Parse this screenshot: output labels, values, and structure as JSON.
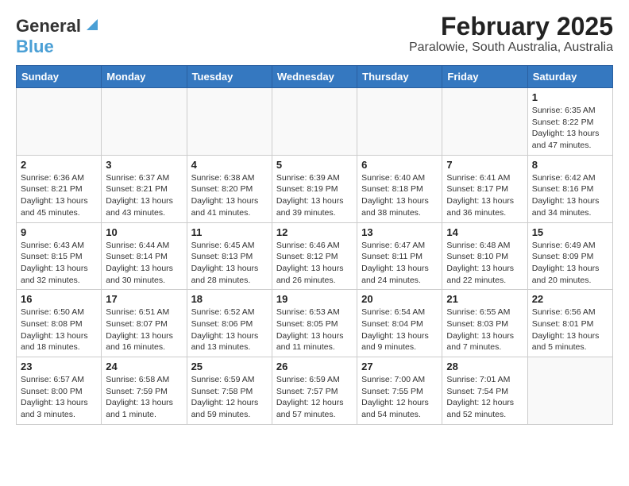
{
  "header": {
    "logo_general": "General",
    "logo_blue": "Blue",
    "title": "February 2025",
    "subtitle": "Paralowie, South Australia, Australia"
  },
  "calendar": {
    "days_of_week": [
      "Sunday",
      "Monday",
      "Tuesday",
      "Wednesday",
      "Thursday",
      "Friday",
      "Saturday"
    ],
    "weeks": [
      [
        {
          "day": "",
          "info": ""
        },
        {
          "day": "",
          "info": ""
        },
        {
          "day": "",
          "info": ""
        },
        {
          "day": "",
          "info": ""
        },
        {
          "day": "",
          "info": ""
        },
        {
          "day": "",
          "info": ""
        },
        {
          "day": "1",
          "info": "Sunrise: 6:35 AM\nSunset: 8:22 PM\nDaylight: 13 hours and 47 minutes."
        }
      ],
      [
        {
          "day": "2",
          "info": "Sunrise: 6:36 AM\nSunset: 8:21 PM\nDaylight: 13 hours and 45 minutes."
        },
        {
          "day": "3",
          "info": "Sunrise: 6:37 AM\nSunset: 8:21 PM\nDaylight: 13 hours and 43 minutes."
        },
        {
          "day": "4",
          "info": "Sunrise: 6:38 AM\nSunset: 8:20 PM\nDaylight: 13 hours and 41 minutes."
        },
        {
          "day": "5",
          "info": "Sunrise: 6:39 AM\nSunset: 8:19 PM\nDaylight: 13 hours and 39 minutes."
        },
        {
          "day": "6",
          "info": "Sunrise: 6:40 AM\nSunset: 8:18 PM\nDaylight: 13 hours and 38 minutes."
        },
        {
          "day": "7",
          "info": "Sunrise: 6:41 AM\nSunset: 8:17 PM\nDaylight: 13 hours and 36 minutes."
        },
        {
          "day": "8",
          "info": "Sunrise: 6:42 AM\nSunset: 8:16 PM\nDaylight: 13 hours and 34 minutes."
        }
      ],
      [
        {
          "day": "9",
          "info": "Sunrise: 6:43 AM\nSunset: 8:15 PM\nDaylight: 13 hours and 32 minutes."
        },
        {
          "day": "10",
          "info": "Sunrise: 6:44 AM\nSunset: 8:14 PM\nDaylight: 13 hours and 30 minutes."
        },
        {
          "day": "11",
          "info": "Sunrise: 6:45 AM\nSunset: 8:13 PM\nDaylight: 13 hours and 28 minutes."
        },
        {
          "day": "12",
          "info": "Sunrise: 6:46 AM\nSunset: 8:12 PM\nDaylight: 13 hours and 26 minutes."
        },
        {
          "day": "13",
          "info": "Sunrise: 6:47 AM\nSunset: 8:11 PM\nDaylight: 13 hours and 24 minutes."
        },
        {
          "day": "14",
          "info": "Sunrise: 6:48 AM\nSunset: 8:10 PM\nDaylight: 13 hours and 22 minutes."
        },
        {
          "day": "15",
          "info": "Sunrise: 6:49 AM\nSunset: 8:09 PM\nDaylight: 13 hours and 20 minutes."
        }
      ],
      [
        {
          "day": "16",
          "info": "Sunrise: 6:50 AM\nSunset: 8:08 PM\nDaylight: 13 hours and 18 minutes."
        },
        {
          "day": "17",
          "info": "Sunrise: 6:51 AM\nSunset: 8:07 PM\nDaylight: 13 hours and 16 minutes."
        },
        {
          "day": "18",
          "info": "Sunrise: 6:52 AM\nSunset: 8:06 PM\nDaylight: 13 hours and 13 minutes."
        },
        {
          "day": "19",
          "info": "Sunrise: 6:53 AM\nSunset: 8:05 PM\nDaylight: 13 hours and 11 minutes."
        },
        {
          "day": "20",
          "info": "Sunrise: 6:54 AM\nSunset: 8:04 PM\nDaylight: 13 hours and 9 minutes."
        },
        {
          "day": "21",
          "info": "Sunrise: 6:55 AM\nSunset: 8:03 PM\nDaylight: 13 hours and 7 minutes."
        },
        {
          "day": "22",
          "info": "Sunrise: 6:56 AM\nSunset: 8:01 PM\nDaylight: 13 hours and 5 minutes."
        }
      ],
      [
        {
          "day": "23",
          "info": "Sunrise: 6:57 AM\nSunset: 8:00 PM\nDaylight: 13 hours and 3 minutes."
        },
        {
          "day": "24",
          "info": "Sunrise: 6:58 AM\nSunset: 7:59 PM\nDaylight: 13 hours and 1 minute."
        },
        {
          "day": "25",
          "info": "Sunrise: 6:59 AM\nSunset: 7:58 PM\nDaylight: 12 hours and 59 minutes."
        },
        {
          "day": "26",
          "info": "Sunrise: 6:59 AM\nSunset: 7:57 PM\nDaylight: 12 hours and 57 minutes."
        },
        {
          "day": "27",
          "info": "Sunrise: 7:00 AM\nSunset: 7:55 PM\nDaylight: 12 hours and 54 minutes."
        },
        {
          "day": "28",
          "info": "Sunrise: 7:01 AM\nSunset: 7:54 PM\nDaylight: 12 hours and 52 minutes."
        },
        {
          "day": "",
          "info": ""
        }
      ]
    ]
  }
}
